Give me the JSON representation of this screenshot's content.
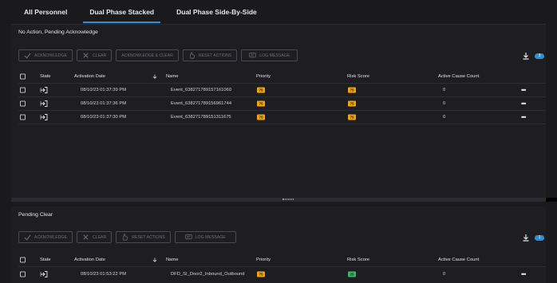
{
  "tabs": [
    {
      "label": "All Personnel",
      "active": false
    },
    {
      "label": "Dual Phase Stacked",
      "active": true
    },
    {
      "label": "Dual Phase Side-By-Side",
      "active": false
    }
  ],
  "top_panel": {
    "title": "No Action, Pending Acknowledge",
    "toolbar": {
      "acknowledge": "ACKNOWLEDGE",
      "clear": "CLEAR",
      "ack_clear": "ACKNOWLEDGE & CLEAR",
      "reset": "RESET ACTIONS",
      "log": "LOG MESSAGE"
    },
    "badge": "3",
    "columns": {
      "state": "State",
      "date": "Activation Date",
      "name": "Name",
      "priority": "Priority",
      "risk": "Risk Score",
      "cause": "Active Cause Count"
    },
    "rows": [
      {
        "date": "08/10/23 01:37:39 PM",
        "name": "Event_638271789157161060",
        "priority": "75",
        "risk": "75",
        "cause": "0",
        "more": "•••"
      },
      {
        "date": "08/10/23 01:37:36 PM",
        "name": "Event_638271789156961744",
        "priority": "75",
        "risk": "75",
        "cause": "0",
        "more": "•••"
      },
      {
        "date": "08/10/23 01:37:30 PM",
        "name": "Event_638271789151311675",
        "priority": "75",
        "risk": "75",
        "cause": "0",
        "more": "•••"
      }
    ]
  },
  "bottom_panel": {
    "title": "Pending Clear",
    "toolbar": {
      "acknowledge": "ACKNOWLEDGE",
      "clear": "CLEAR",
      "reset": "RESET ACTIONS",
      "log": "LOG MESSAGE"
    },
    "badge": "1",
    "columns": {
      "state": "State",
      "date": "Activation Date",
      "name": "Name",
      "priority": "Priority",
      "risk": "Risk Score",
      "cause": "Active Cause Count"
    },
    "rows": [
      {
        "date": "08/10/23 01:53:22 PM",
        "name": "DFD_SI_Door2_Inbound_Outbound",
        "priority": "75",
        "risk": "25",
        "cause": "0",
        "more": "•••"
      }
    ]
  },
  "icons": {
    "check": "check-icon",
    "close": "x-icon",
    "reset": "hand-pointer-icon",
    "log": "message-icon",
    "download": "download-icon",
    "state": "state-login-icon",
    "sort": "sort-down-icon",
    "more": "more-horizontal-icon"
  },
  "colors": {
    "accent": "#2e8fd6",
    "priority_orange": "#f0a50c",
    "risk_green": "#3fb56a",
    "background": "#1a1a1d"
  }
}
